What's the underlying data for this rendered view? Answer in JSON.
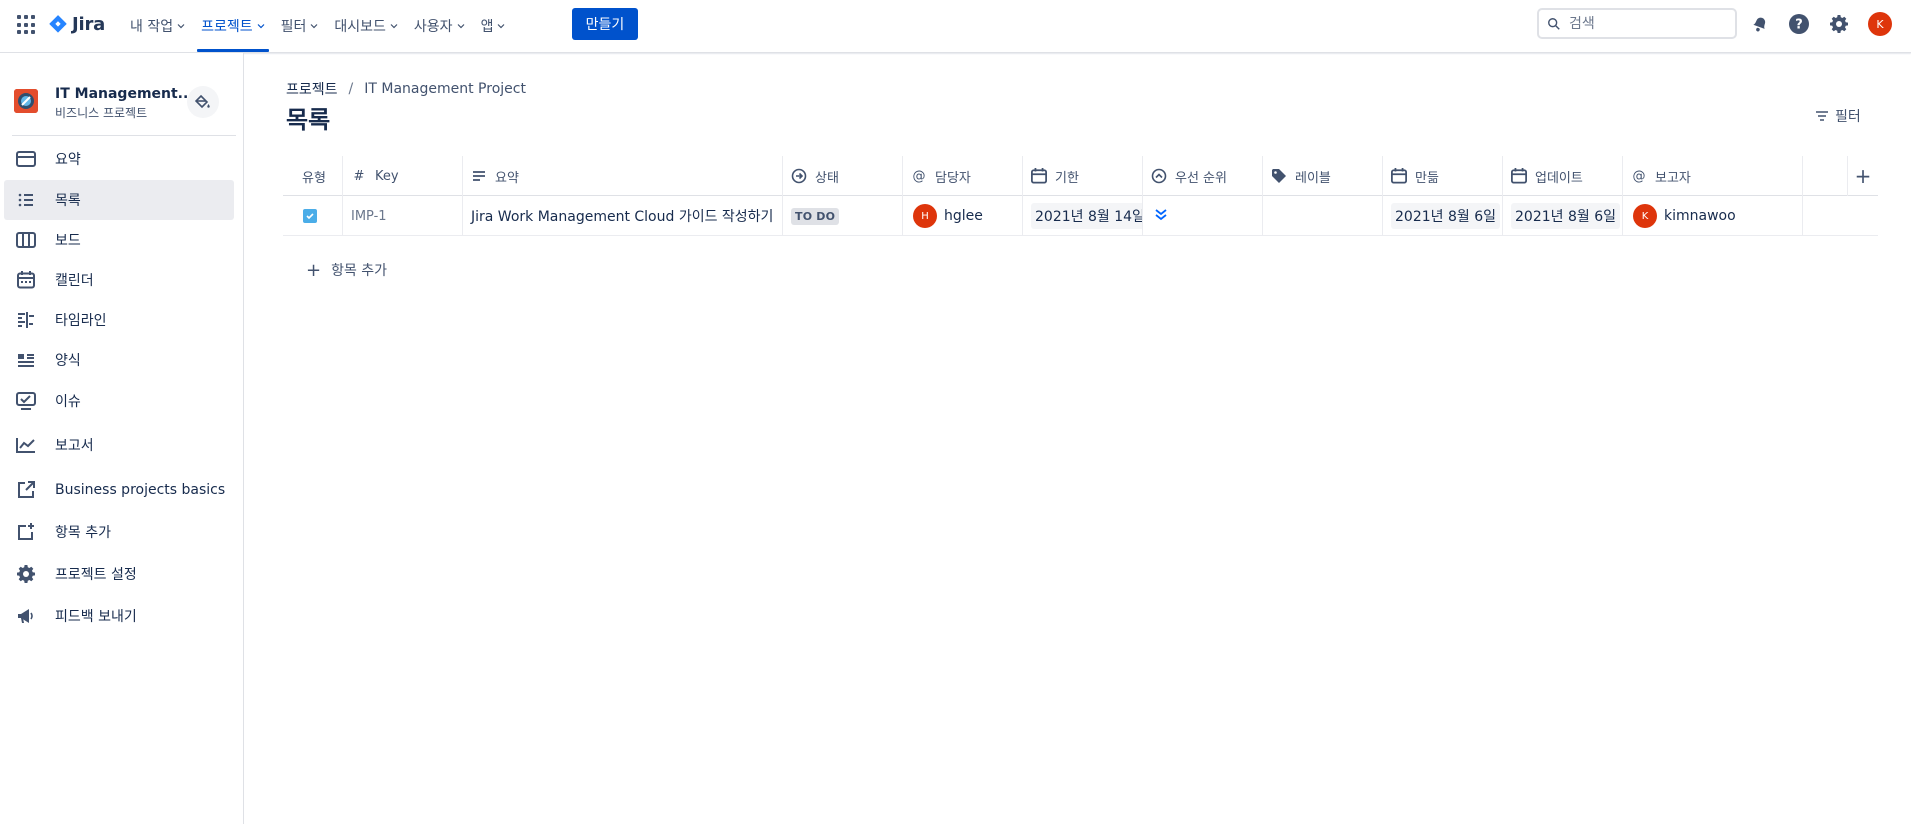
{
  "topnav": {
    "logo_text": "Jira",
    "items": [
      {
        "label": "내 작업"
      },
      {
        "label": "프로젝트"
      },
      {
        "label": "필터"
      },
      {
        "label": "대시보드"
      },
      {
        "label": "사용자"
      },
      {
        "label": "앱"
      }
    ],
    "active_index": 1,
    "create_label": "만들기",
    "search_placeholder": "검색",
    "avatar_initial": "K"
  },
  "sidebar": {
    "project_name": "IT Management...",
    "project_type": "비즈니스 프로젝트",
    "items": [
      {
        "label": "요약",
        "icon": "summary-icon"
      },
      {
        "label": "목록",
        "icon": "list-icon",
        "selected": true
      },
      {
        "label": "보드",
        "icon": "board-icon"
      },
      {
        "label": "캘린더",
        "icon": "calendar-icon"
      },
      {
        "label": "타임라인",
        "icon": "timeline-icon"
      },
      {
        "label": "양식",
        "icon": "form-icon"
      },
      {
        "label": "이슈",
        "icon": "issues-icon"
      },
      {
        "label": "보고서",
        "icon": "reports-icon"
      },
      {
        "label": "Business projects basics",
        "icon": "external-link-icon"
      },
      {
        "label": "항목 추가",
        "icon": "add-item-icon"
      },
      {
        "label": "프로젝트 설정",
        "icon": "gear-icon"
      },
      {
        "label": "피드백 보내기",
        "icon": "megaphone-icon"
      }
    ]
  },
  "main": {
    "breadcrumb": [
      "프로젝트",
      "IT Management Project"
    ],
    "breadcrumb_sep": "/",
    "title": "목록",
    "filter_label": "필터",
    "add_item_label": "항목 추가"
  },
  "table": {
    "columns": [
      {
        "label": "유형",
        "icon": ""
      },
      {
        "label": "Key",
        "icon": "#"
      },
      {
        "label": "요약",
        "icon": "summary-lines-icon"
      },
      {
        "label": "상태",
        "icon": "status-arrow-icon"
      },
      {
        "label": "담당자",
        "icon": "@"
      },
      {
        "label": "기한",
        "icon": "calendar-icon"
      },
      {
        "label": "우선 순위",
        "icon": "priority-icon"
      },
      {
        "label": "레이블",
        "icon": "tag-icon"
      },
      {
        "label": "만듦",
        "icon": "calendar-icon"
      },
      {
        "label": "업데이트",
        "icon": "calendar-icon"
      },
      {
        "label": "보고자",
        "icon": "@"
      }
    ],
    "rows": [
      {
        "key": "IMP-1",
        "summary": "Jira Work Management Cloud 가이드 작성하기",
        "status": "TO DO",
        "assignee": {
          "name": "hglee",
          "initial": "H"
        },
        "due": "2021년 8월 14일",
        "priority": "lowest",
        "labels": "",
        "created": "2021년 8월 6일",
        "updated": "2021년 8월 6일",
        "reporter": {
          "name": "kimnawoo",
          "initial": "K"
        }
      }
    ]
  },
  "colors": {
    "primary": "#0052cc",
    "avatar": "#de350b",
    "task_type": "#4bade8",
    "priority_low": "#0065ff"
  }
}
